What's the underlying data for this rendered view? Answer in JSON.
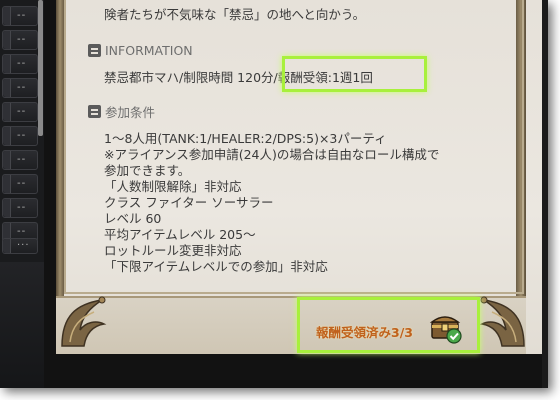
{
  "sidebar": {
    "slots": [
      "--",
      "--",
      "--",
      "--",
      "--",
      "--",
      "--",
      "--",
      "--",
      "--",
      "···"
    ]
  },
  "main": {
    "intro_line": "険者たちが不気味な「禁忌」の地へと向かう。",
    "information": {
      "header": "INFORMATION",
      "icon": "document-icon",
      "line": "禁忌都市マハ/制限時間 120分/報酬受領:1週1回"
    },
    "conditions": {
      "header": "参加条件",
      "icon": "document-icon",
      "lines": [
        "1～8人用(TANK:1/HEALER:2/DPS:5)×3パーティ",
        "※アライアンス参加申請(24人)の場合は自由なロール構成で",
        "参加できます。",
        "「人数制限解除」非対応",
        "クラス ファイター ソーサラー",
        "レベル 60",
        "平均アイテムレベル 205～",
        "ロットルール変更非対応",
        "「下限アイテムレベルでの参加」非対応"
      ]
    }
  },
  "footer": {
    "reward_status": "報酬受領済み3/3",
    "chest_icon": "treasure-chest-check-icon"
  },
  "colors": {
    "highlight": "#a8f03c",
    "reward_text": "#c0611c",
    "panel_bg": "#e6e1d9"
  }
}
